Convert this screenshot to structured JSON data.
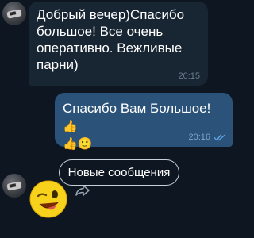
{
  "incoming": {
    "text": "Добрый вечер)Спасибо большое! Все очень оперативно. Вежливые парни)",
    "time": "20:15"
  },
  "outgoing": {
    "text": "Спасибо Вам Большое!",
    "emoji_1": "👍",
    "emoji_2": "👍",
    "emoji_3": "🙂",
    "time": "20:16",
    "status_icon": "double-check-icon"
  },
  "new_messages_button": {
    "label": "Новые сообщения"
  },
  "sticker": {
    "icon": "winking-face-sticker",
    "share_icon": "share-forward-icon"
  },
  "colors": {
    "background": "#0e1621",
    "incoming_bubble": "#182533",
    "outgoing_bubble": "#2b5278",
    "accent": "#5ea2e6"
  }
}
